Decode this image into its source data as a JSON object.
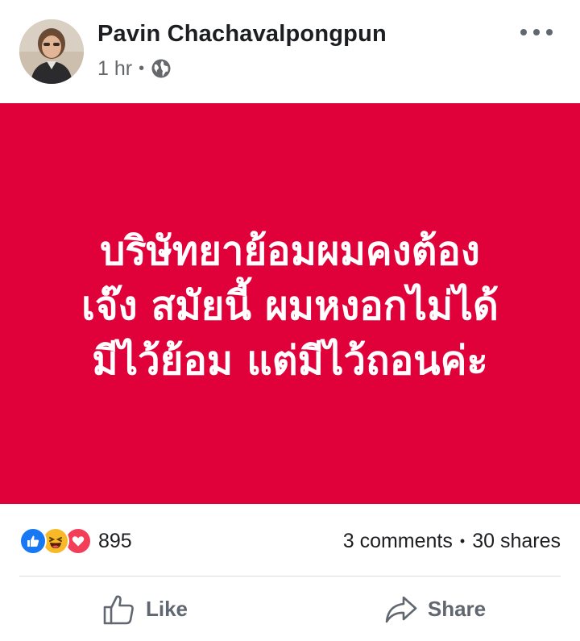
{
  "post": {
    "author": "Pavin Chachavalpongpun",
    "time": "1 hr",
    "separator": "•",
    "privacy_icon": "globe-icon",
    "more_icon": "more-options-icon",
    "background_color": "#e0003a",
    "text_lines": [
      "บริษัทยาย้อมผมคงต้อง",
      "เจ๊ง สมัยนี้ ผมหงอกไม่ได้",
      "มีไว้ย้อม แต่มีไว้ถอนค่ะ"
    ]
  },
  "engagement": {
    "reactions": [
      "like",
      "haha",
      "love"
    ],
    "reaction_count": "895",
    "comments": "3 comments",
    "separator": "•",
    "shares": "30 shares"
  },
  "actions": {
    "like_label": "Like",
    "share_label": "Share"
  },
  "colors": {
    "like_blue": "#1877f2",
    "haha_yellow": "#f7b928",
    "love_red": "#f33e58",
    "action_gray": "#606770"
  }
}
